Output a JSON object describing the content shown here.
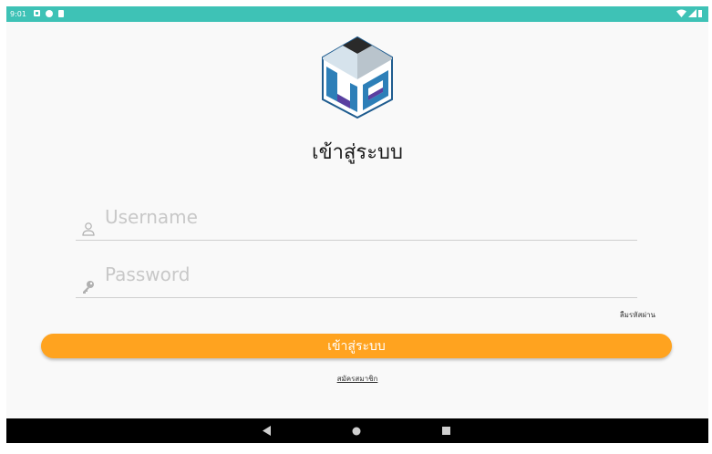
{
  "status_bar": {
    "time": "9:01",
    "background_color": "#3ec2b6"
  },
  "logo": {
    "icon": "cube-logo-icon"
  },
  "title": "เข้าสู่ระบบ",
  "form": {
    "username": {
      "placeholder": "Username",
      "value": "",
      "icon": "user-icon"
    },
    "password": {
      "placeholder": "Password",
      "value": "",
      "icon": "key-icon"
    },
    "forgot_password": "ลืมรหัสผ่าน",
    "login_button": "เข้าสู่ระบบ",
    "register_link": "สมัครสมาชิก"
  },
  "colors": {
    "accent": "#ffa31f",
    "status_bar": "#3ec2b6"
  },
  "nav_bar": {
    "back_icon": "back-triangle-icon",
    "home_icon": "home-circle-icon",
    "recents_icon": "recents-square-icon"
  }
}
